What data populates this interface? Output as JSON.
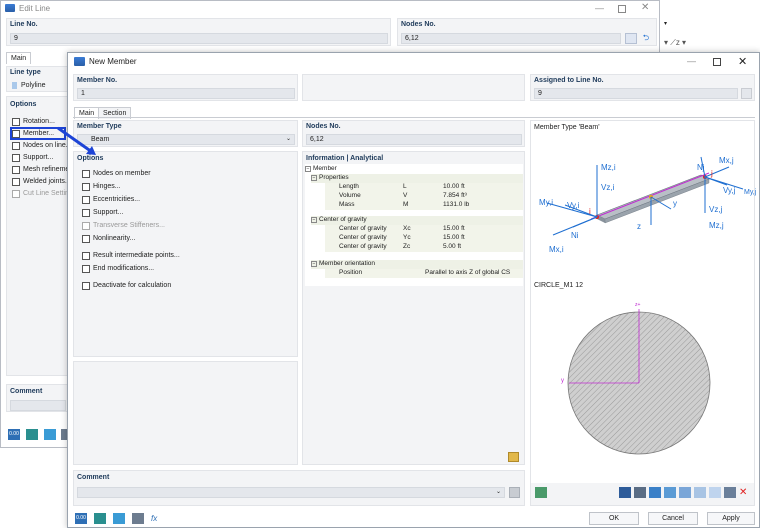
{
  "edit_line": {
    "title": "Edit Line",
    "line_no_label": "Line No.",
    "line_no_value": "9",
    "nodes_no_label": "Nodes No.",
    "nodes_no_value": "6,12",
    "tab_main": "Main",
    "line_type_label": "Line type",
    "line_type_value": "Polyline",
    "options_label": "Options",
    "options": [
      "Rotation...",
      "Member...",
      "Nodes on line...",
      "Support...",
      "Mesh refinement",
      "Welded joints...",
      "Cut Line Setting"
    ],
    "comment_label": "Comment"
  },
  "new_member": {
    "title": "New Member",
    "member_no_label": "Member No.",
    "member_no_value": "1",
    "assigned_label": "Assigned to Line No.",
    "assigned_value": "9",
    "tabs": [
      "Main",
      "Section"
    ],
    "member_type_label": "Member Type",
    "member_type_value": "Beam",
    "nodes_no_label": "Nodes No.",
    "nodes_no_value": "6,12",
    "options_label": "Options",
    "options": [
      "Nodes on member",
      "Hinges...",
      "Eccentricities...",
      "Support...",
      "Transverse Stiffeners...",
      "Nonlinearity...",
      "Result intermediate points...",
      "End modifications...",
      "Deactivate for calculation"
    ],
    "info_label": "Information | Analytical",
    "tree": {
      "member": "Member",
      "properties": "Properties",
      "props": [
        {
          "name": "Length",
          "sym": "L",
          "val": "10.00 ft"
        },
        {
          "name": "Volume",
          "sym": "V",
          "val": "7.854 ft³"
        },
        {
          "name": "Mass",
          "sym": "M",
          "val": "1131.0 lb"
        }
      ],
      "cog": "Center of gravity",
      "cog_rows": [
        {
          "name": "Center of gravity",
          "sym": "Xc",
          "val": "15.00 ft"
        },
        {
          "name": "Center of gravity",
          "sym": "Yc",
          "val": "15.00 ft"
        },
        {
          "name": "Center of gravity",
          "sym": "Zc",
          "val": "5.00 ft"
        }
      ],
      "orient": "Member orientation",
      "orient_row": {
        "name": "Position",
        "val": "Parallel to axis Z of global CS"
      }
    },
    "preview_title": "Member Type 'Beam'",
    "section_label": "CIRCLE_M1 12",
    "axis_labels": {
      "mx_right": "Mx,j",
      "nj": "Nj",
      "vyj": "Vy,j",
      "myj": "My,j",
      "vzj": "Vz,j",
      "mzj": "Mz,j",
      "mzi": "Mz,i",
      "vzi": "Vz,i",
      "myi": "My,i",
      "vyi": "Vy,i",
      "ni": "Ni",
      "mxi": "Mx,i",
      "j": "j",
      "i": "i",
      "y": "y",
      "z": "z"
    },
    "section_axis": {
      "z": "z+",
      "y": "y"
    },
    "comment_label": "Comment",
    "buttons": {
      "ok": "OK",
      "cancel": "Cancel",
      "apply": "Apply"
    },
    "footer_units": "0.00"
  },
  "colors": {
    "accent_blue": "#1f6fd1",
    "highlight": "#1d44d6",
    "label": "#1e3a5a",
    "magenta": "#c02bd2",
    "red": "#e02020"
  }
}
